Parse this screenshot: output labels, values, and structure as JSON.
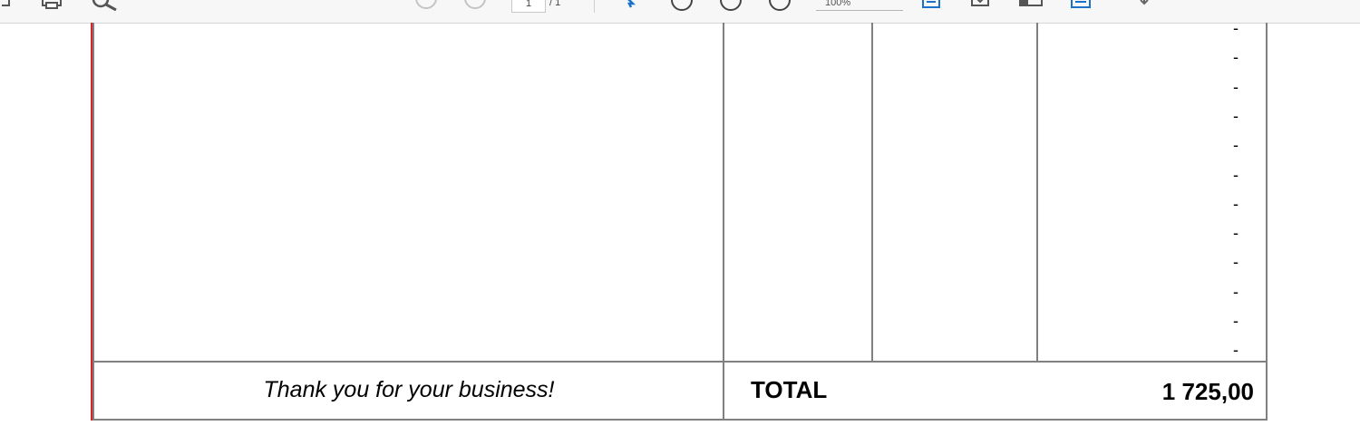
{
  "toolbar": {
    "page_current": "1",
    "page_total": "/ 1",
    "zoom": "100%",
    "icons": [
      "share-icon",
      "print-icon",
      "search-icon",
      "page-up-icon",
      "page-down-icon",
      "select-tool-icon",
      "zoom-out-icon",
      "zoom-in-icon",
      "zoom-reset-icon",
      "fit-page-icon",
      "download-icon",
      "sidebar-icon",
      "fit-width-icon",
      "more-icon"
    ]
  },
  "invoice": {
    "dashes": [
      "-",
      "-",
      "-",
      "-",
      "-",
      "-",
      "-",
      "-",
      "-",
      "-",
      "-",
      "-"
    ],
    "footer_note": "Thank you for your business!",
    "total_label": "TOTAL",
    "total_value": "1 725,00"
  }
}
